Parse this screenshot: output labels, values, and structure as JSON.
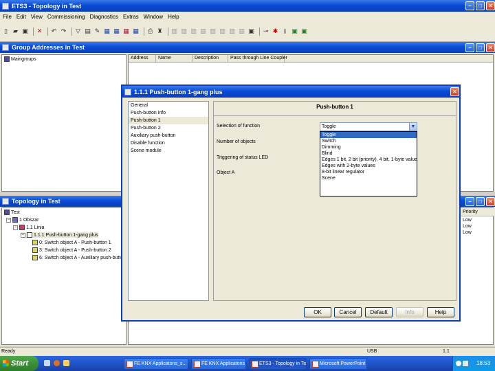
{
  "app": {
    "title": "ETS3 - Topology in Test",
    "menu": [
      "File",
      "Edit",
      "View",
      "Commissioning",
      "Diagnostics",
      "Extras",
      "Window",
      "Help"
    ]
  },
  "group_addresses": {
    "title": "Group Addresses in Test",
    "tree_root": "Maingroups",
    "columns": [
      "Address",
      "Name",
      "Description",
      "Pass through Line Coupler"
    ]
  },
  "topology": {
    "title": "Topology in Test",
    "tree": {
      "root": "Test",
      "area": "1 Obszar",
      "line": "1.1 Linia",
      "device": "1.1.1 Push-button 1-gang plus",
      "objects": [
        "0: Switch object A - Push-button 1",
        "3: Switch object A - Push-button 2",
        "6: Switch object A - Auxiliary push-button"
      ]
    },
    "priority_header": "Priority",
    "priority_values": [
      "Low",
      "Low",
      "Low"
    ]
  },
  "dialog": {
    "title": "1.1.1 Push-button 1-gang plus",
    "nav_items": [
      "General",
      "Push-button info",
      "Push-button 1",
      "Push-button 2",
      "Auxiliary push-button",
      "Disable function",
      "Scene module"
    ],
    "selected_nav": "Push-button 1",
    "panel_title": "Push-button 1",
    "labels": {
      "selection_of_function": "Selection of function",
      "number_of_objects": "Number of objects",
      "triggering_status_led": "Triggering of status LED",
      "object_a": "Object A"
    },
    "function_value": "Toggle",
    "function_options": [
      "Toggle",
      "Switch",
      "Dimming",
      "Blind",
      "Edges 1 bit, 2 bit (priority), 4 bit, 1-byte value",
      "Edges with 2-byte values",
      "8-bit linear regulator",
      "Scene"
    ],
    "buttons": {
      "ok": "OK",
      "cancel": "Cancel",
      "default": "Default",
      "info": "Info",
      "help": "Help"
    }
  },
  "statusbar": {
    "left": "Ready",
    "usb": "USB",
    "address": "1.1"
  },
  "taskbar": {
    "start": "Start",
    "tasks": [
      "FE KNX Applicatons_s...",
      "FE KNX Applicatons_b...",
      "ETS3 - Topology in Test",
      "Microsoft PowerPoint"
    ],
    "clock": "18:53"
  },
  "colors": {
    "titlebar": "#0a4bd6",
    "selection": "#316ac5",
    "start_button": "#3c8f37"
  }
}
